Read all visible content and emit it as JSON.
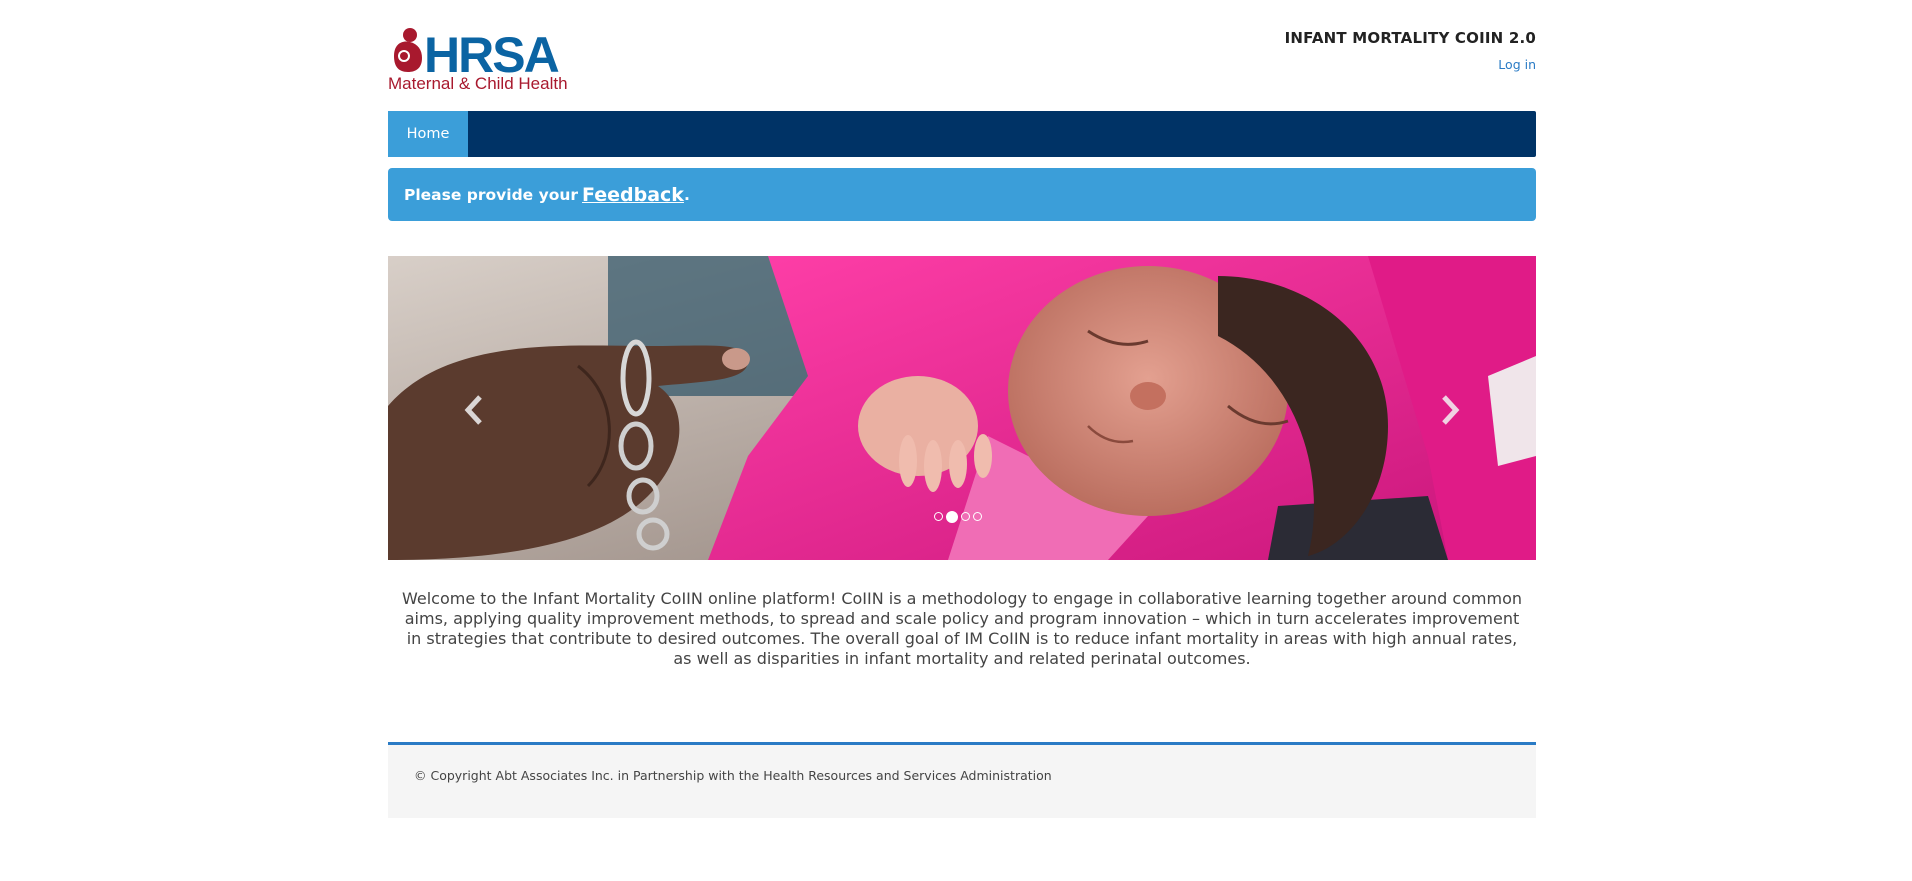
{
  "logo": {
    "wordmark": "HRSA",
    "subtitle": "Maternal & Child Health",
    "icon": "mother-child-icon",
    "colors": {
      "wordmark": "#0b64a3",
      "accent": "#a8192e"
    }
  },
  "header": {
    "site_title": "INFANT MORTALITY COIIN 2.0",
    "login_label": "Log in"
  },
  "nav": {
    "items": [
      {
        "label": "Home",
        "active": true
      }
    ],
    "colors": {
      "bar": "#003366",
      "active": "#3b9ed9"
    }
  },
  "feedback": {
    "prefix": "Please provide your",
    "link_label": "Feedback",
    "suffix": "."
  },
  "carousel": {
    "prev_icon": "chevron-left-icon",
    "next_icon": "chevron-right-icon",
    "slide_count": 4,
    "active_index": 1
  },
  "welcome": {
    "text": "Welcome to the Infant Mortality CoIIN online platform! CoIIN is a methodology to engage in collaborative learning together around common aims, applying quality improvement methods, to spread and scale policy and program innovation – which in turn accelerates improvement in strategies that contribute to desired outcomes. The overall goal of IM CoIIN is to reduce infant mortality in areas with high annual rates, as well as disparities in infant mortality and related perinatal outcomes."
  },
  "footer": {
    "copyright": "© Copyright Abt Associates Inc. in Partnership with the Health Resources and Services Administration",
    "accent_color": "#2a7bc5"
  }
}
